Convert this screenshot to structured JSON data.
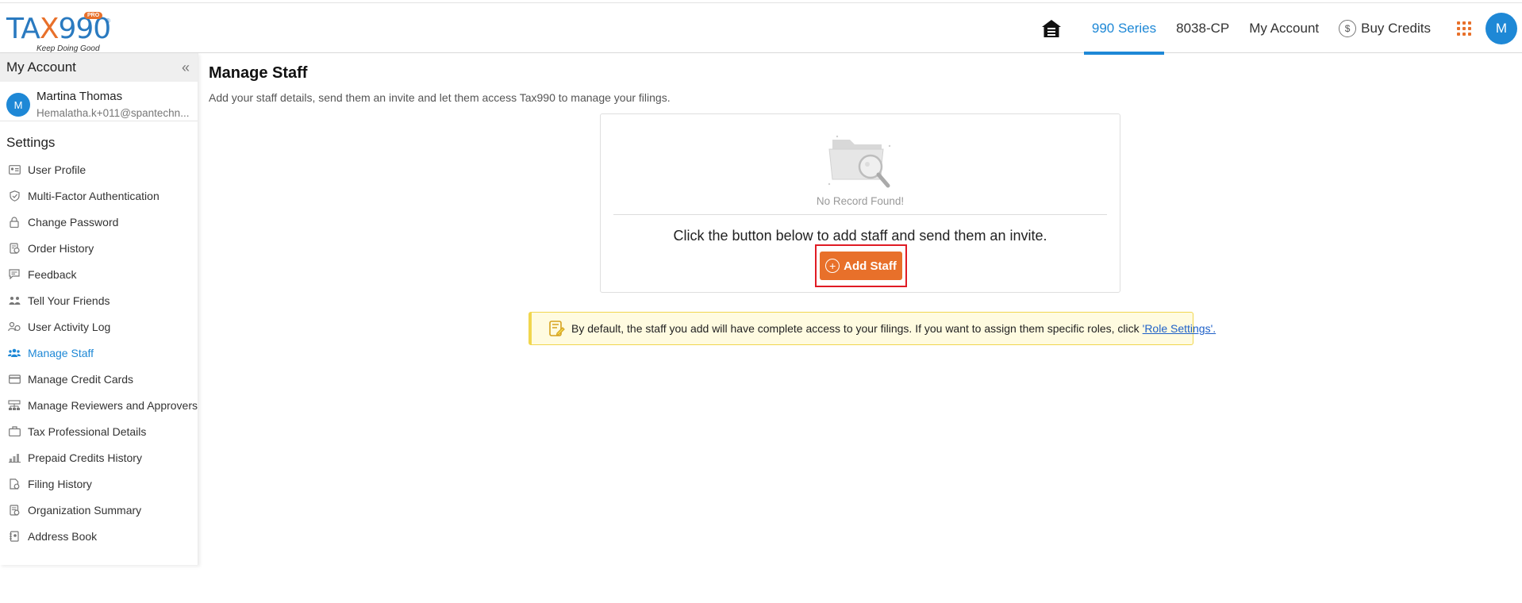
{
  "brand": {
    "logo_text_left": "TA",
    "logo_text_x": "X",
    "logo_text_right": "990",
    "badge": "PRO",
    "registered": "®",
    "tagline": "Keep Doing Good",
    "colors": {
      "primary": "#1e88d6",
      "accent": "#e8702a"
    }
  },
  "nav": {
    "home_icon": "home-icon",
    "links": [
      "990 Series",
      "8038-CP",
      "My Account"
    ],
    "active": "990 Series",
    "credits_symbol": "$",
    "credits_label": "Buy Credits",
    "apps_icon": "apps-grid-icon",
    "avatar_initial": "M"
  },
  "sidebar": {
    "title": "My Account",
    "collapse_icon": "«",
    "user": {
      "initial": "M",
      "name": "Martina Thomas",
      "email": "Hemalatha.k+011@spantechn..."
    },
    "section": "Settings",
    "items": [
      {
        "label": "User Profile",
        "icon": "id-card-icon"
      },
      {
        "label": "Multi-Factor Authentication",
        "icon": "shield-check-icon"
      },
      {
        "label": "Change Password",
        "icon": "lock-icon"
      },
      {
        "label": "Order History",
        "icon": "order-history-icon"
      },
      {
        "label": "Feedback",
        "icon": "feedback-icon"
      },
      {
        "label": "Tell Your Friends",
        "icon": "friends-icon"
      },
      {
        "label": "User Activity Log",
        "icon": "activity-log-icon"
      },
      {
        "label": "Manage Staff",
        "icon": "staff-icon",
        "active": true
      },
      {
        "label": "Manage Credit Cards",
        "icon": "credit-card-icon"
      },
      {
        "label": "Manage Reviewers and Approvers",
        "icon": "reviewers-icon"
      },
      {
        "label": "Tax Professional Details",
        "icon": "briefcase-icon"
      },
      {
        "label": "Prepaid Credits History",
        "icon": "prepaid-credits-icon"
      },
      {
        "label": "Filing History",
        "icon": "filing-history-icon"
      },
      {
        "label": "Organization Summary",
        "icon": "organization-summary-icon"
      },
      {
        "label": "Address Book",
        "icon": "address-book-icon"
      }
    ]
  },
  "main": {
    "title": "Manage Staff",
    "description": "Add your staff details, send them an invite and let them access Tax990 to manage your filings.",
    "empty_state": {
      "icon": "empty-folder-search-icon",
      "text": "No Record Found!"
    },
    "prompt": "Click the button below to add staff and send them an invite.",
    "add_button": "Add Staff",
    "notice": {
      "icon": "note-icon",
      "text": "By default, the staff you add will have complete access to your filings. If you want to assign them specific roles, click",
      "link": "'Role Settings'."
    }
  }
}
